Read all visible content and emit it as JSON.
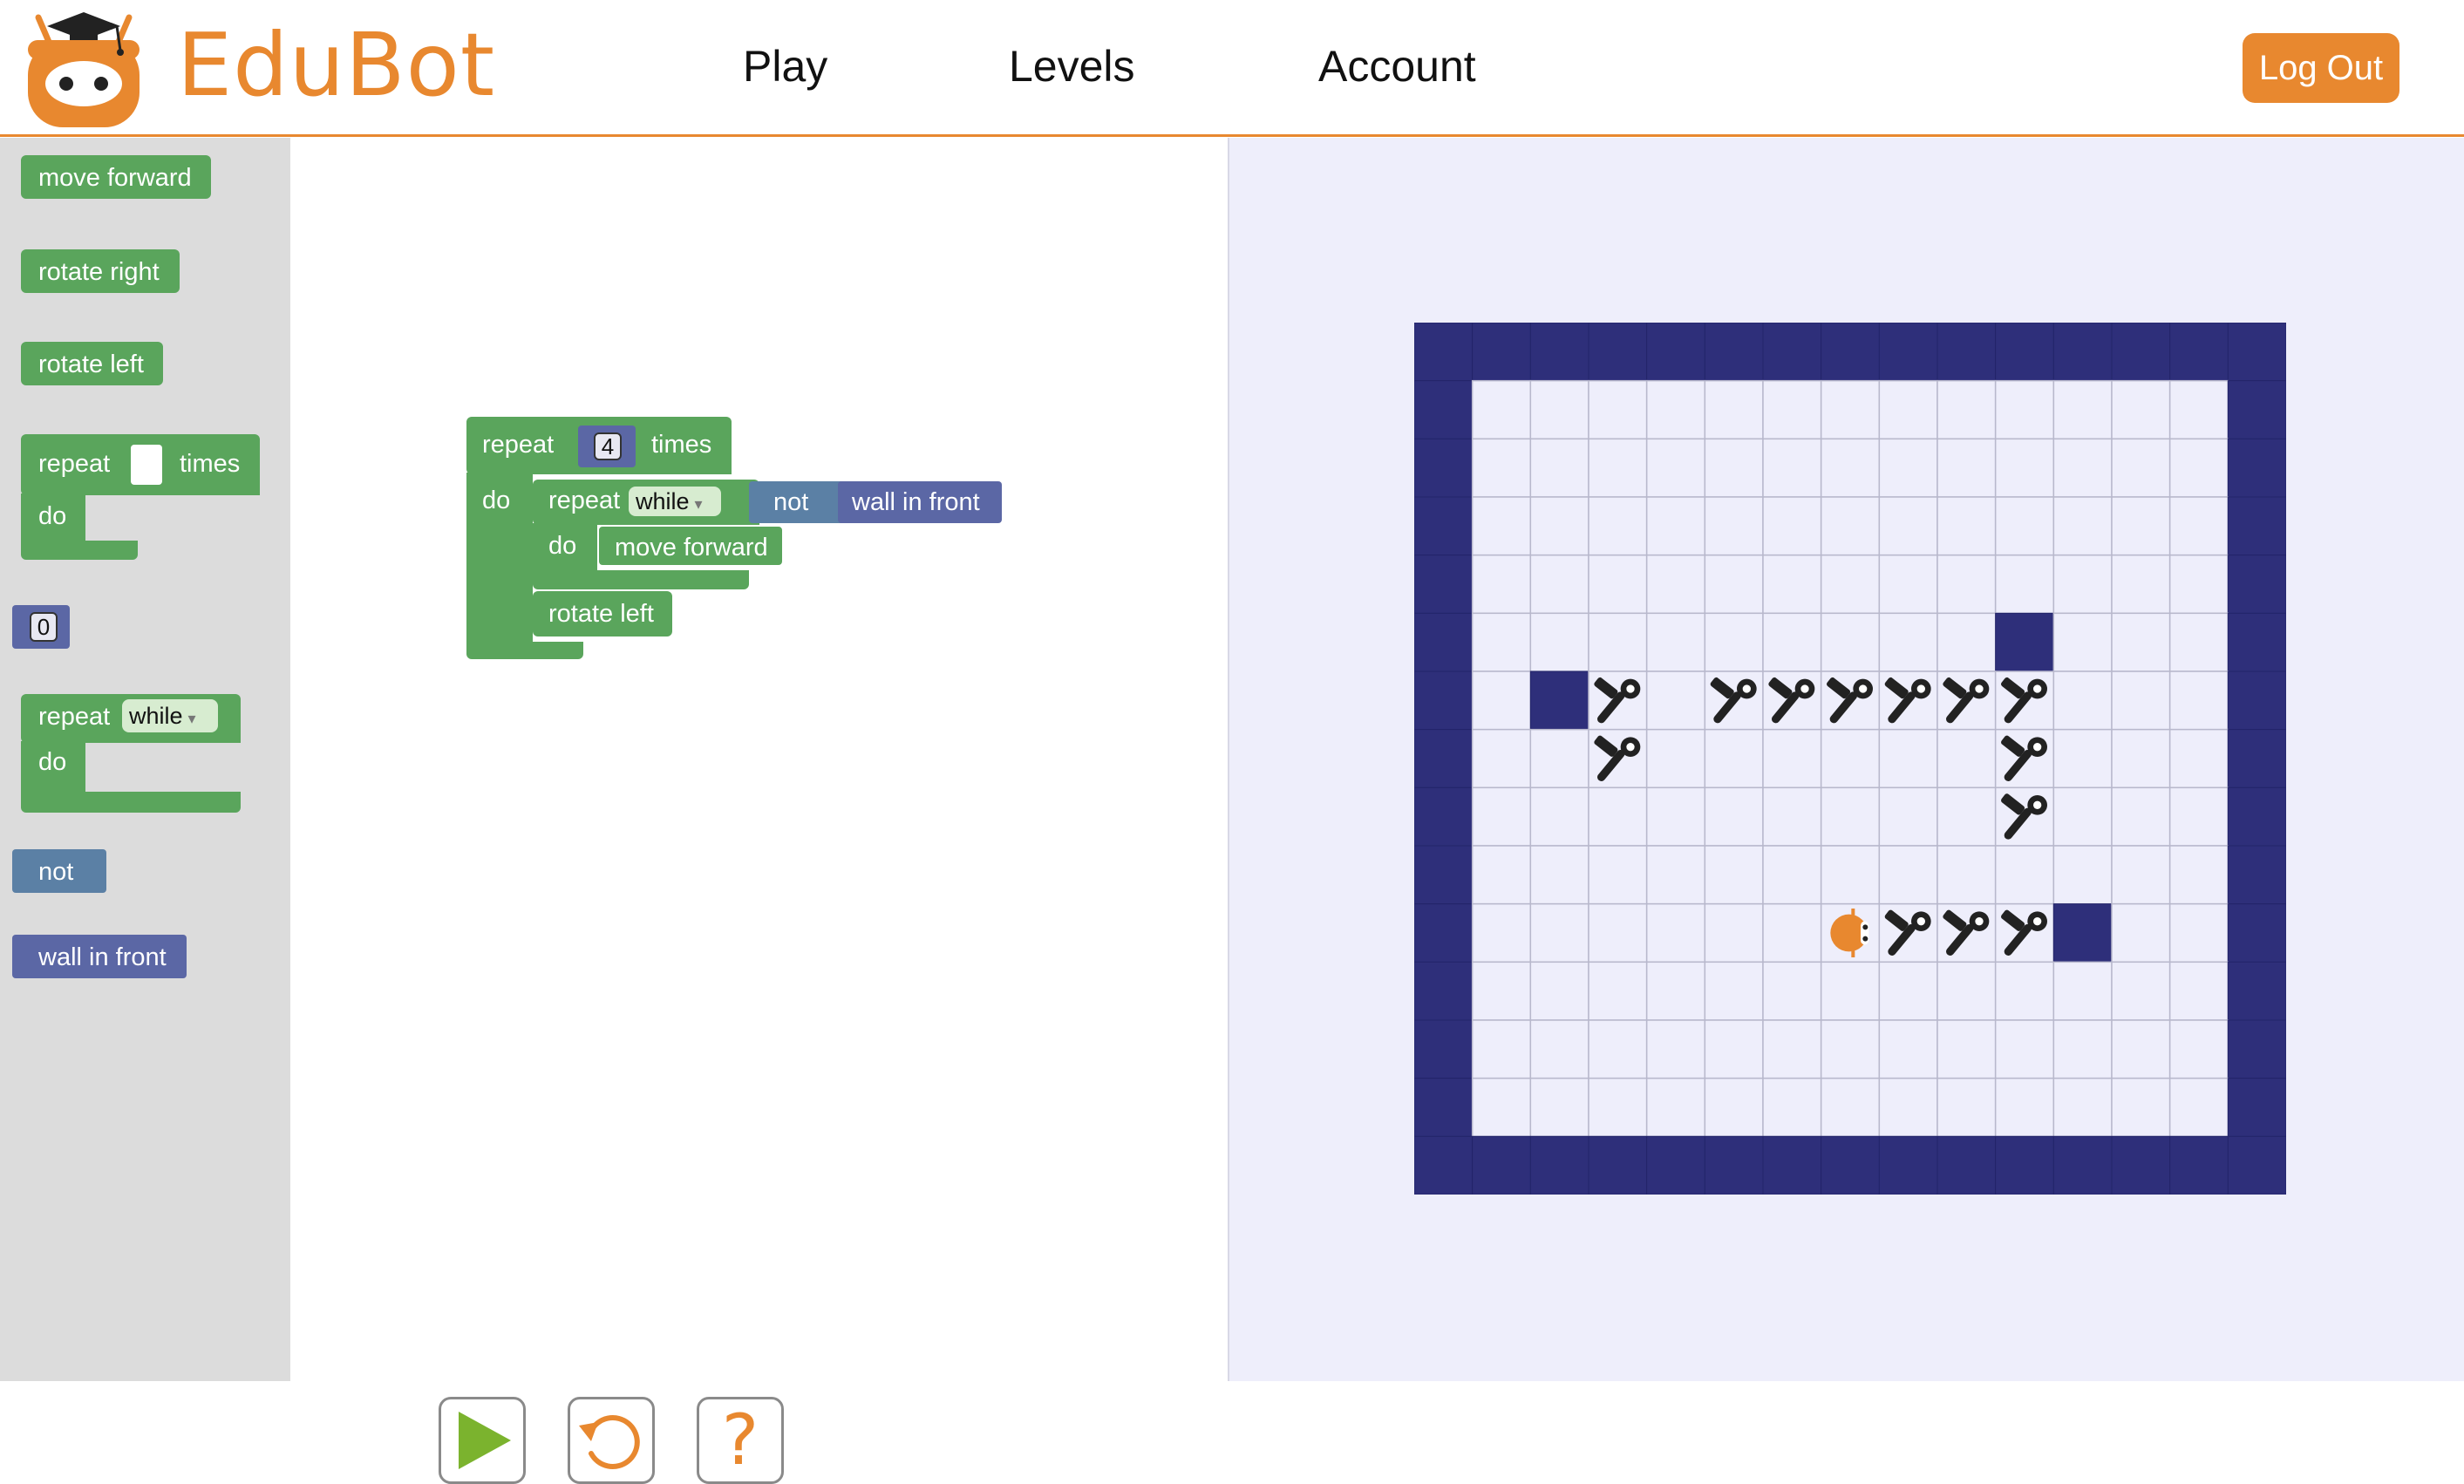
{
  "app": {
    "brand": "EduBot"
  },
  "nav": {
    "play": "Play",
    "levels": "Levels",
    "account": "Account",
    "logout": "Log Out"
  },
  "toolbox": {
    "move_forward": "move forward",
    "rotate_right": "rotate right",
    "rotate_left": "rotate left",
    "repeat_label": "repeat",
    "times_label": "times",
    "do_label": "do",
    "number_value": "0",
    "repeat_while_label": "repeat",
    "while_option": "while",
    "do_label2": "do",
    "not_label": "not",
    "wall_in_front": "wall in front"
  },
  "program": {
    "repeat_label": "repeat",
    "count": "4",
    "times_label": "times",
    "do_label": "do",
    "inner_repeat_label": "repeat",
    "while_option": "while",
    "not_label": "not",
    "condition": "wall in front",
    "inner_do_label": "do",
    "move_forward": "move forward",
    "rotate_left": "rotate left"
  },
  "controls": {
    "run_icon": "play-icon",
    "reset_icon": "reset-icon",
    "help_label": "?"
  },
  "colors": {
    "accent": "#e8882f",
    "block_green": "#5aa55c",
    "block_blue": "#5b80a5",
    "block_purple": "#5b67a5",
    "wall": "#2e2f7a",
    "floor": "#eeeefb"
  },
  "maze": {
    "cols": 15,
    "rows": 15,
    "inner_walls": [
      [
        10,
        5
      ],
      [
        2,
        6
      ],
      [
        11,
        10
      ]
    ],
    "bolts": [
      [
        3,
        6
      ],
      [
        5,
        6
      ],
      [
        6,
        6
      ],
      [
        7,
        6
      ],
      [
        8,
        6
      ],
      [
        9,
        6
      ],
      [
        10,
        6
      ],
      [
        3,
        7
      ],
      [
        10,
        7
      ],
      [
        10,
        8
      ],
      [
        8,
        10
      ],
      [
        9,
        10
      ],
      [
        10,
        10
      ]
    ],
    "robot": [
      7,
      10
    ]
  }
}
